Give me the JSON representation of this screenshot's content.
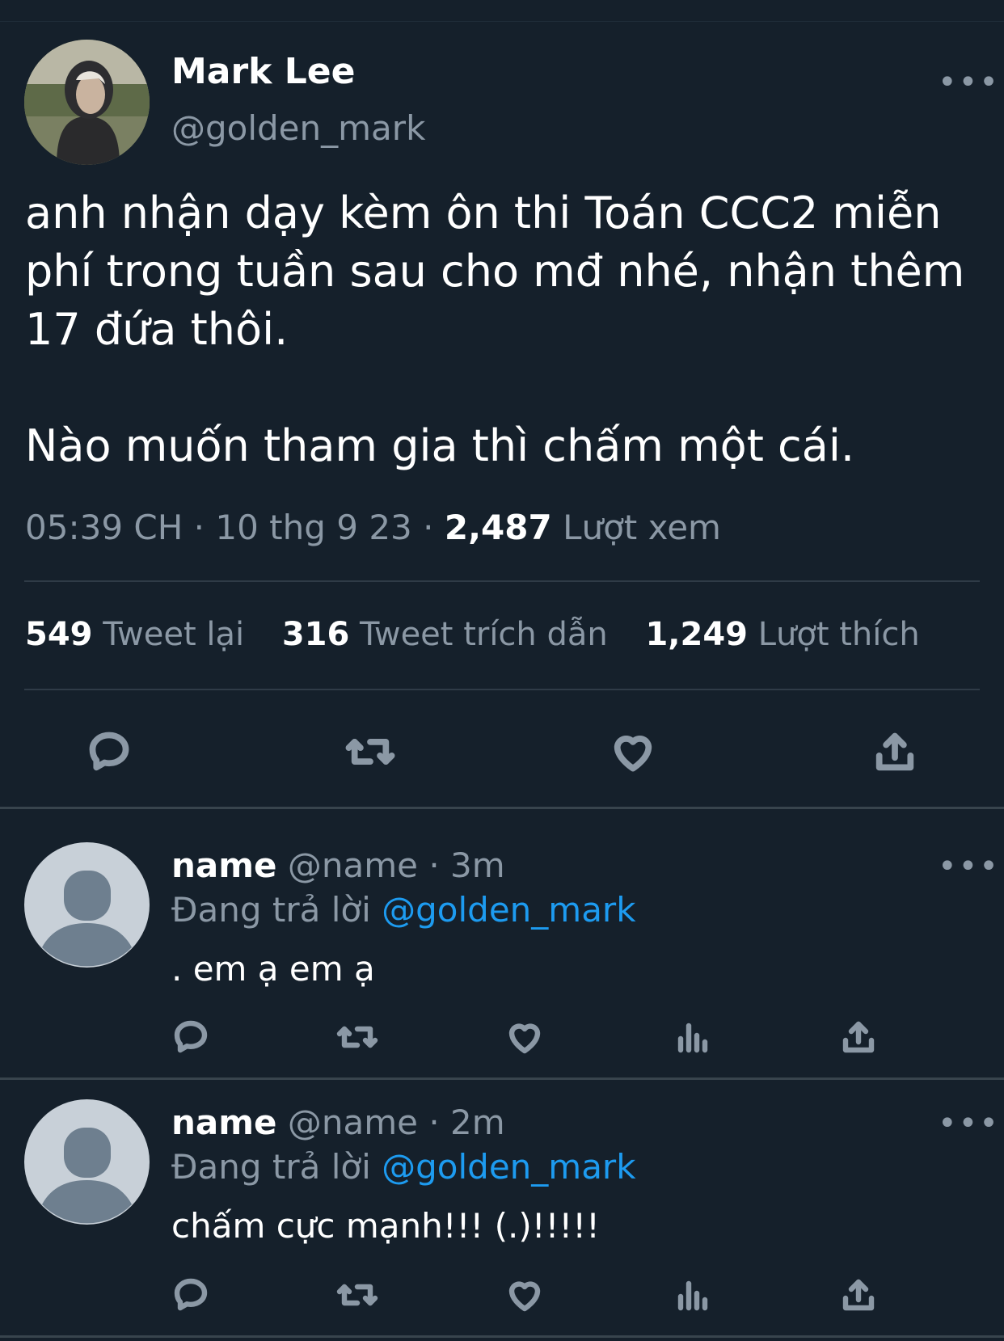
{
  "tweet": {
    "author_name": "Mark Lee",
    "author_handle": "@golden_mark",
    "more_label": "•••",
    "text_para1": "anh nhận dạy kèm ôn thi Toán CCC2 miễn phí trong tuần sau cho mđ nhé, nhận thêm 17 đứa thôi.",
    "text_para2": "Nào muốn tham gia thì chấm một cái.",
    "time": "05:39 CH",
    "date": "10 thg 9 23",
    "views_count": "2,487",
    "views_label": "Lượt xem",
    "sep": "·"
  },
  "stats": {
    "retweets_count": "549",
    "retweets_label": "Tweet lại",
    "quotes_count": "316",
    "quotes_label": "Tweet trích dẫn",
    "likes_count": "1,249",
    "likes_label": "Lượt thích"
  },
  "replies": [
    {
      "name": "name",
      "handle": "@name",
      "sep": "·",
      "time": "3m",
      "replying_label": "Đang trả lời",
      "replying_to": "@golden_mark",
      "text": ". em ạ em ạ"
    },
    {
      "name": "name",
      "handle": "@name",
      "sep": "·",
      "time": "2m",
      "replying_label": "Đang trả lời",
      "replying_to": "@golden_mark",
      "text": "chấm cực mạnh!!! (.)!!!!!"
    }
  ],
  "icons": {
    "reply": "reply-bubble-icon",
    "retweet": "retweet-icon",
    "like": "heart-icon",
    "views": "analytics-bars-icon",
    "share": "share-upload-icon"
  },
  "colors": {
    "background": "#15202b",
    "secondary_text": "#8b98a5",
    "mention": "#1d9bf0",
    "divider": "#2f3b47"
  }
}
